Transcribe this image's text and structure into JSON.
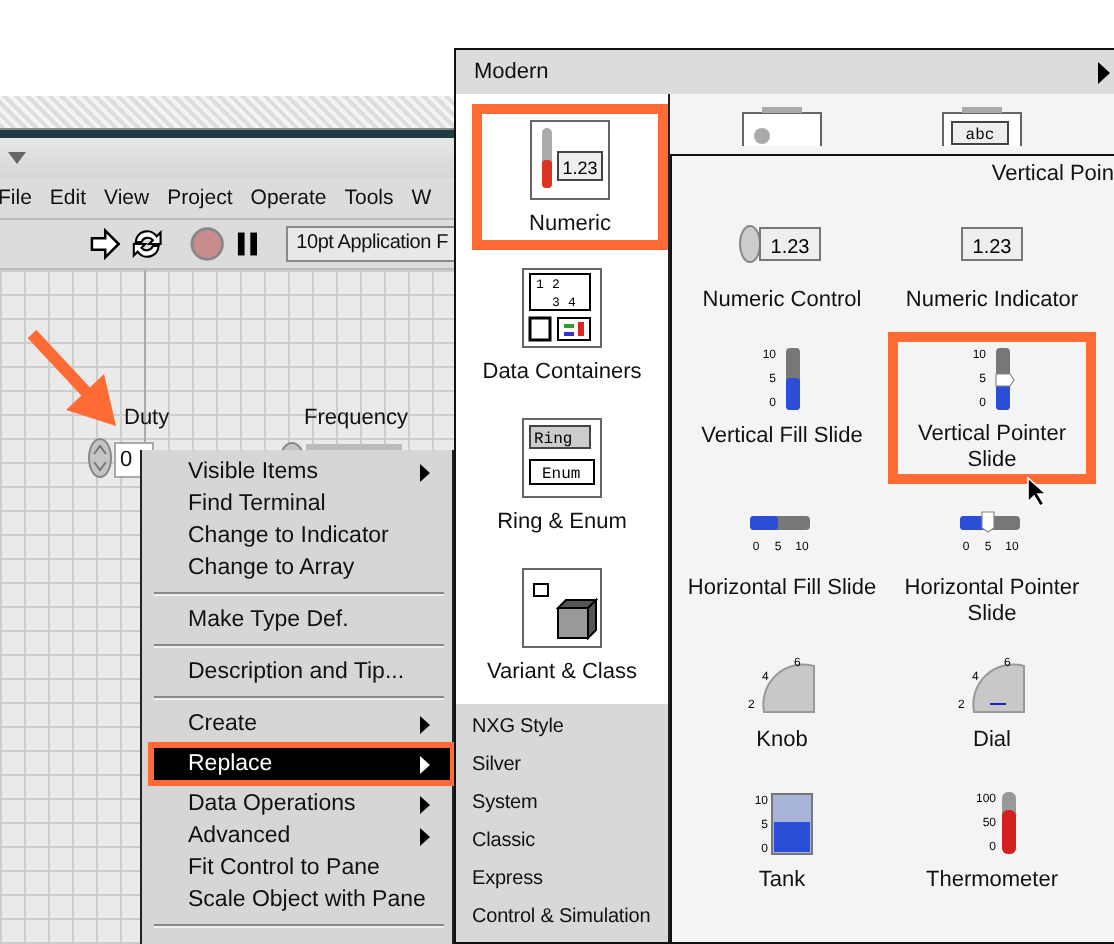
{
  "editor": {
    "menu": [
      "File",
      "Edit",
      "View",
      "Project",
      "Operate",
      "Tools",
      "W"
    ],
    "font_selector": "10pt Application F"
  },
  "front_panel": {
    "controls": [
      {
        "label": "Duty",
        "value": "0"
      },
      {
        "label": "Frequency"
      }
    ]
  },
  "context_menu": {
    "items": [
      {
        "kind": "item",
        "label": "Visible Items",
        "submenu": true,
        "selected": false
      },
      {
        "kind": "item",
        "label": "Find Terminal",
        "submenu": false,
        "selected": false
      },
      {
        "kind": "item",
        "label": "Change to Indicator",
        "submenu": false,
        "selected": false
      },
      {
        "kind": "item",
        "label": "Change to Array",
        "submenu": false,
        "selected": false
      },
      {
        "kind": "separator"
      },
      {
        "kind": "item",
        "label": "Make Type Def.",
        "submenu": false,
        "selected": false
      },
      {
        "kind": "separator"
      },
      {
        "kind": "item",
        "label": "Description and Tip...",
        "submenu": false,
        "selected": false
      },
      {
        "kind": "separator"
      },
      {
        "kind": "item",
        "label": "Create",
        "submenu": true,
        "selected": false
      },
      {
        "kind": "item",
        "label": "Replace",
        "submenu": true,
        "selected": true
      },
      {
        "kind": "item",
        "label": "Data Operations",
        "submenu": true,
        "selected": false
      },
      {
        "kind": "item",
        "label": "Advanced",
        "submenu": true,
        "selected": false
      },
      {
        "kind": "item",
        "label": "Fit Control to Pane",
        "submenu": false,
        "selected": false
      },
      {
        "kind": "item",
        "label": "Scale Object with Pane",
        "submenu": false,
        "selected": false
      },
      {
        "kind": "separator"
      }
    ]
  },
  "palette": {
    "title": "Modern",
    "categories": [
      {
        "kind": "numeric",
        "label": "Numeric",
        "icon_text": [
          "1.23"
        ],
        "selected": true
      },
      {
        "kind": "containers",
        "label": "Data Containers",
        "icon_text": [
          "1",
          "2",
          "3",
          "4"
        ],
        "selected": false
      },
      {
        "kind": "ring",
        "label": "Ring & Enum",
        "icon_text": [
          "Ring",
          "Enum"
        ],
        "selected": false
      },
      {
        "kind": "variant",
        "label": "Variant & Class",
        "selected": false
      }
    ],
    "hidden_row": [
      {
        "kind": "boolean"
      },
      {
        "kind": "string",
        "icon_text": [
          "abc"
        ]
      }
    ],
    "styles": [
      "NXG Style",
      "Silver",
      "System",
      "Classic",
      "Express",
      "Control & Simulation"
    ]
  },
  "numeric_palette": {
    "hover_title": "Vertical Poin",
    "items": [
      {
        "kind": "numeric-control",
        "label": "Numeric Control",
        "icon_text": [
          "1.23"
        ],
        "selected": false
      },
      {
        "kind": "numeric-indicator",
        "label": "Numeric Indicator",
        "icon_text": [
          "1.23"
        ],
        "selected": false
      },
      {
        "kind": "vertical-fill",
        "label": "Vertical Fill Slide",
        "icon_text": [
          "10",
          "5",
          "0"
        ],
        "selected": false
      },
      {
        "kind": "vertical-pointer",
        "label": "Vertical Pointer Slide",
        "icon_text": [
          "10",
          "5",
          "0"
        ],
        "selected": true
      },
      {
        "kind": "horizontal-fill",
        "label": "Horizontal Fill Slide",
        "icon_text": [
          "0",
          "5",
          "10"
        ],
        "selected": false
      },
      {
        "kind": "horizontal-pointer",
        "label": "Horizontal Pointer Slide",
        "icon_text": [
          "0",
          "5",
          "10"
        ],
        "selected": false
      },
      {
        "kind": "knob",
        "label": "Knob",
        "icon_text": [
          "2",
          "4",
          "6"
        ],
        "selected": false
      },
      {
        "kind": "dial",
        "label": "Dial",
        "icon_text": [
          "2",
          "4",
          "6"
        ],
        "selected": false
      },
      {
        "kind": "tank",
        "label": "Tank",
        "icon_text": [
          "10",
          "5",
          "0"
        ],
        "selected": false
      },
      {
        "kind": "thermometer",
        "label": "Thermometer",
        "icon_text": [
          "100",
          "50",
          "0"
        ],
        "selected": false
      }
    ]
  }
}
